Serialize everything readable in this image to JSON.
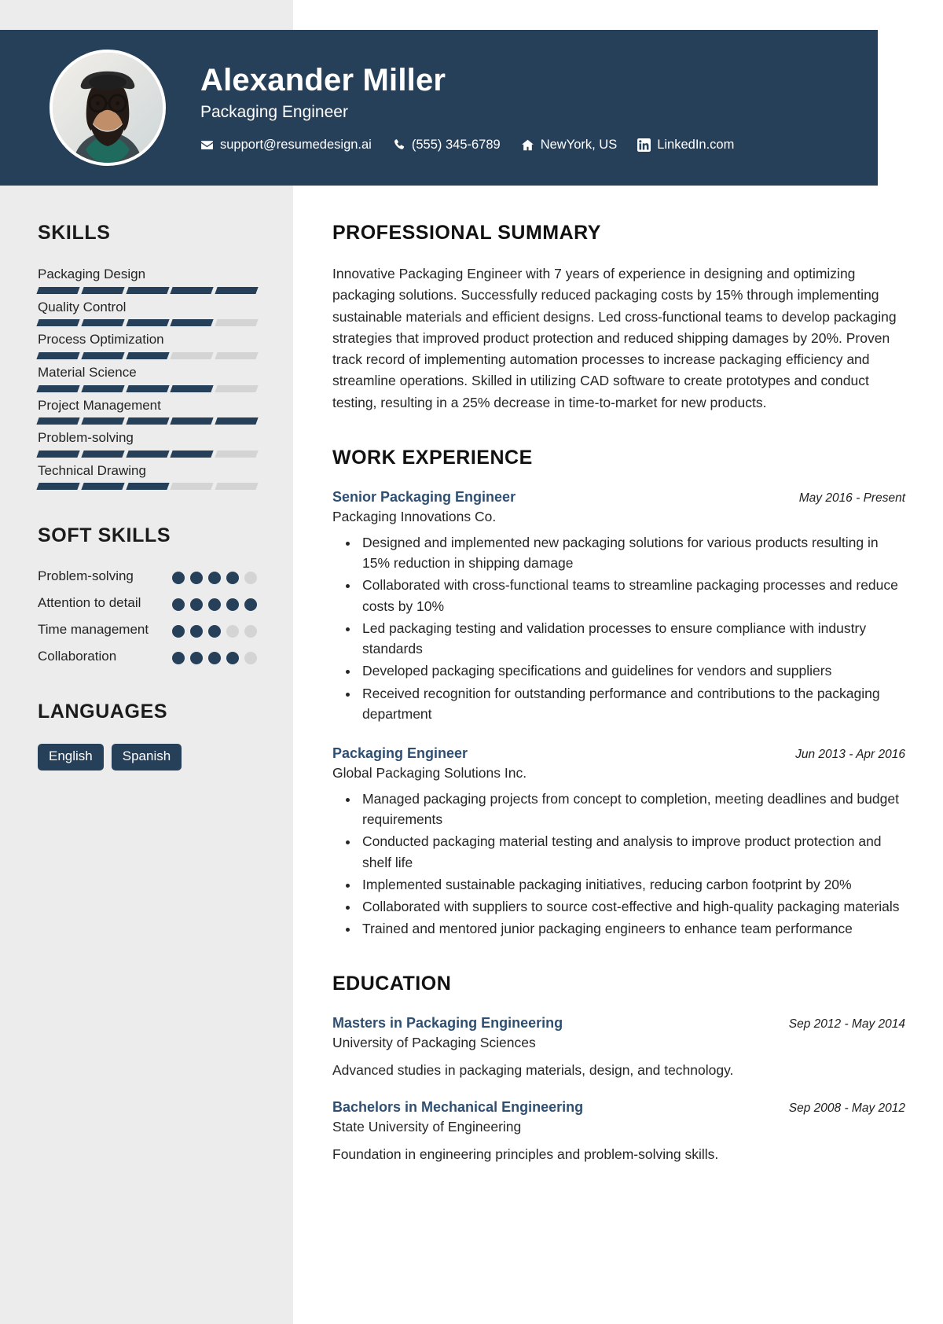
{
  "header": {
    "name": "Alexander Miller",
    "role": "Packaging Engineer",
    "avatar_icon": "person-photo",
    "contacts": [
      {
        "icon": "envelope-icon",
        "text": "support@resumedesign.ai"
      },
      {
        "icon": "phone-icon",
        "text": "(555) 345-6789"
      },
      {
        "icon": "home-icon",
        "text": "NewYork, US"
      },
      {
        "icon": "linkedin-icon",
        "text": "LinkedIn.com"
      }
    ]
  },
  "sidebar": {
    "skills_title": "SKILLS",
    "skills": [
      {
        "name": "Packaging Design",
        "level": 5,
        "max": 5
      },
      {
        "name": "Quality Control",
        "level": 4,
        "max": 5
      },
      {
        "name": "Process Optimization",
        "level": 3,
        "max": 5
      },
      {
        "name": "Material Science",
        "level": 4,
        "max": 5
      },
      {
        "name": "Project Management",
        "level": 5,
        "max": 5
      },
      {
        "name": "Problem-solving",
        "level": 4,
        "max": 5
      },
      {
        "name": "Technical Drawing",
        "level": 3,
        "max": 5
      }
    ],
    "soft_skills_title": "SOFT SKILLS",
    "soft_skills": [
      {
        "name": "Problem-solving",
        "level": 4,
        "max": 5
      },
      {
        "name": "Attention to detail",
        "level": 5,
        "max": 5
      },
      {
        "name": "Time management",
        "level": 3,
        "max": 5
      },
      {
        "name": "Collaboration",
        "level": 4,
        "max": 5
      }
    ],
    "languages_title": "LANGUAGES",
    "languages": [
      "English",
      "Spanish"
    ]
  },
  "main": {
    "summary_title": "PROFESSIONAL SUMMARY",
    "summary_text": "Innovative Packaging Engineer with 7 years of experience in designing and optimizing packaging solutions. Successfully reduced packaging costs by 15% through implementing sustainable materials and efficient designs. Led cross-functional teams to develop packaging strategies that improved product protection and reduced shipping damages by 20%. Proven track record of implementing automation processes to increase packaging efficiency and streamline operations. Skilled in utilizing CAD software to create prototypes and conduct testing, resulting in a 25% decrease in time-to-market for new products.",
    "experience_title": "WORK EXPERIENCE",
    "experience": [
      {
        "title": "Senior Packaging Engineer",
        "date": "May 2016 - Present",
        "org": "Packaging Innovations Co.",
        "bullets": [
          "Designed and implemented new packaging solutions for various products resulting in 15% reduction in shipping damage",
          "Collaborated with cross-functional teams to streamline packaging processes and reduce costs by 10%",
          "Led packaging testing and validation processes to ensure compliance with industry standards",
          "Developed packaging specifications and guidelines for vendors and suppliers",
          "Received recognition for outstanding performance and contributions to the packaging department"
        ]
      },
      {
        "title": "Packaging Engineer",
        "date": "Jun 2013 - Apr 2016",
        "org": "Global Packaging Solutions Inc.",
        "bullets": [
          "Managed packaging projects from concept to completion, meeting deadlines and budget requirements",
          "Conducted packaging material testing and analysis to improve product protection and shelf life",
          "Implemented sustainable packaging initiatives, reducing carbon footprint by 20%",
          "Collaborated with suppliers to source cost-effective and high-quality packaging materials",
          "Trained and mentored junior packaging engineers to enhance team performance"
        ]
      }
    ],
    "education_title": "EDUCATION",
    "education": [
      {
        "title": "Masters in Packaging Engineering",
        "date": "Sep 2012 - May 2014",
        "org": "University of Packaging Sciences",
        "desc": "Advanced studies in packaging materials, design, and technology."
      },
      {
        "title": "Bachelors in Mechanical Engineering",
        "date": "Sep 2008 - May 2012",
        "org": "State University of Engineering",
        "desc": "Foundation in engineering principles and problem-solving skills."
      }
    ]
  },
  "theme": {
    "accent": "#27405a",
    "link": "#2f4f72",
    "sidebar_bg": "#ececec",
    "bar_off": "#d4d4d4"
  }
}
